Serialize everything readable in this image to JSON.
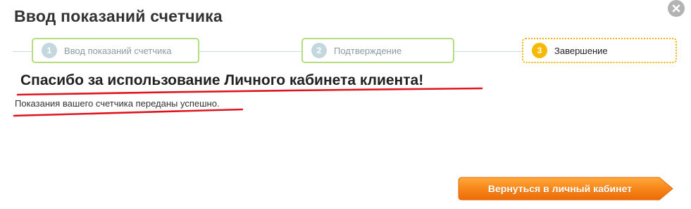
{
  "dialog": {
    "title": "Ввод показаний счетчика",
    "close_icon": "close-x-icon"
  },
  "steps": [
    {
      "number": "1",
      "label": "Ввод показаний счетчика",
      "state": "done"
    },
    {
      "number": "2",
      "label": "Подтверждение",
      "state": "done"
    },
    {
      "number": "3",
      "label": "Завершение",
      "state": "active"
    }
  ],
  "result": {
    "heading": "Спасибо за использование Личного кабинета клиента!",
    "message": "Показания вашего счетчика переданы успешно."
  },
  "actions": {
    "back_label": "Вернуться в личный кабинет"
  },
  "colors": {
    "done_border": "#b5dd7d",
    "active_border": "#f2b300",
    "active_number": "#f6b800",
    "button_orange": "#f7861b",
    "annotation_red": "#e0141e"
  }
}
